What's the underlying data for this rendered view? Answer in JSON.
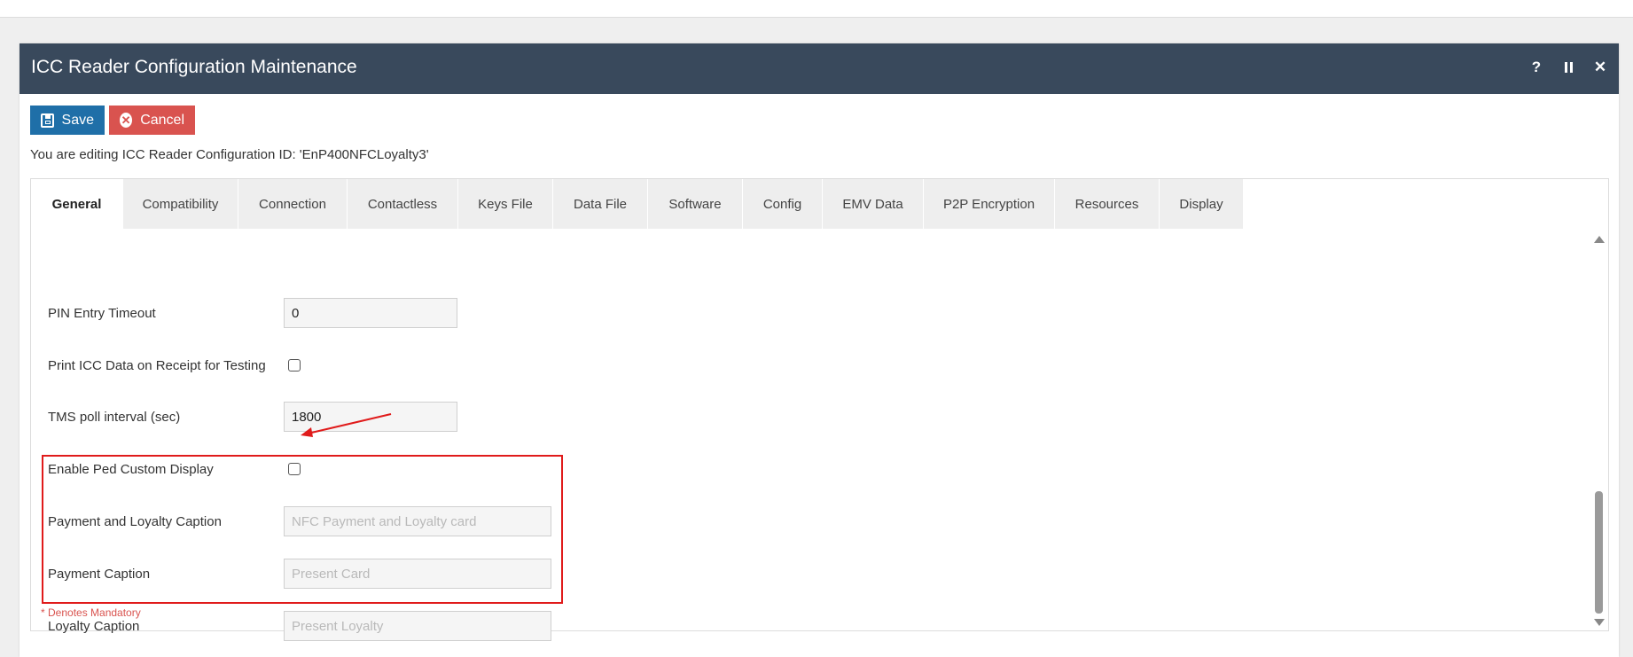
{
  "dialog": {
    "title": "ICC Reader Configuration Maintenance",
    "help_glyph": "?",
    "close_glyph": "✕"
  },
  "toolbar": {
    "save_label": "Save",
    "cancel_label": "Cancel",
    "cancel_glyph": "✕"
  },
  "editing_text": "You are editing ICC Reader Configuration ID: 'EnP400NFCLoyalty3'",
  "tabs": [
    {
      "label": "General",
      "active": true
    },
    {
      "label": "Compatibility"
    },
    {
      "label": "Connection"
    },
    {
      "label": "Contactless"
    },
    {
      "label": "Keys File"
    },
    {
      "label": "Data File"
    },
    {
      "label": "Software"
    },
    {
      "label": "Config"
    },
    {
      "label": "EMV Data"
    },
    {
      "label": "P2P Encryption"
    },
    {
      "label": "Resources"
    },
    {
      "label": "Display"
    }
  ],
  "form": {
    "pin_timeout": {
      "label": "PIN Entry Timeout",
      "value": "0"
    },
    "print_icc": {
      "label": "Print ICC Data on Receipt for Testing",
      "checked": false
    },
    "tms_poll": {
      "label": "TMS poll interval (sec)",
      "value": "1800"
    },
    "ped_display": {
      "label": "Enable Ped Custom Display",
      "checked": false
    },
    "payment_loyalty_caption": {
      "label": "Payment and Loyalty Caption",
      "placeholder": "NFC Payment and Loyalty card"
    },
    "payment_caption": {
      "label": "Payment Caption",
      "placeholder": "Present Card"
    },
    "loyalty_caption": {
      "label": "Loyalty Caption",
      "placeholder": "Present Loyalty"
    }
  },
  "mandatory_note": "* Denotes Mandatory",
  "colors": {
    "titlebar": "#39495c",
    "save": "#1f6fa8",
    "cancel": "#d9534f",
    "highlight": "#e01b1b"
  }
}
